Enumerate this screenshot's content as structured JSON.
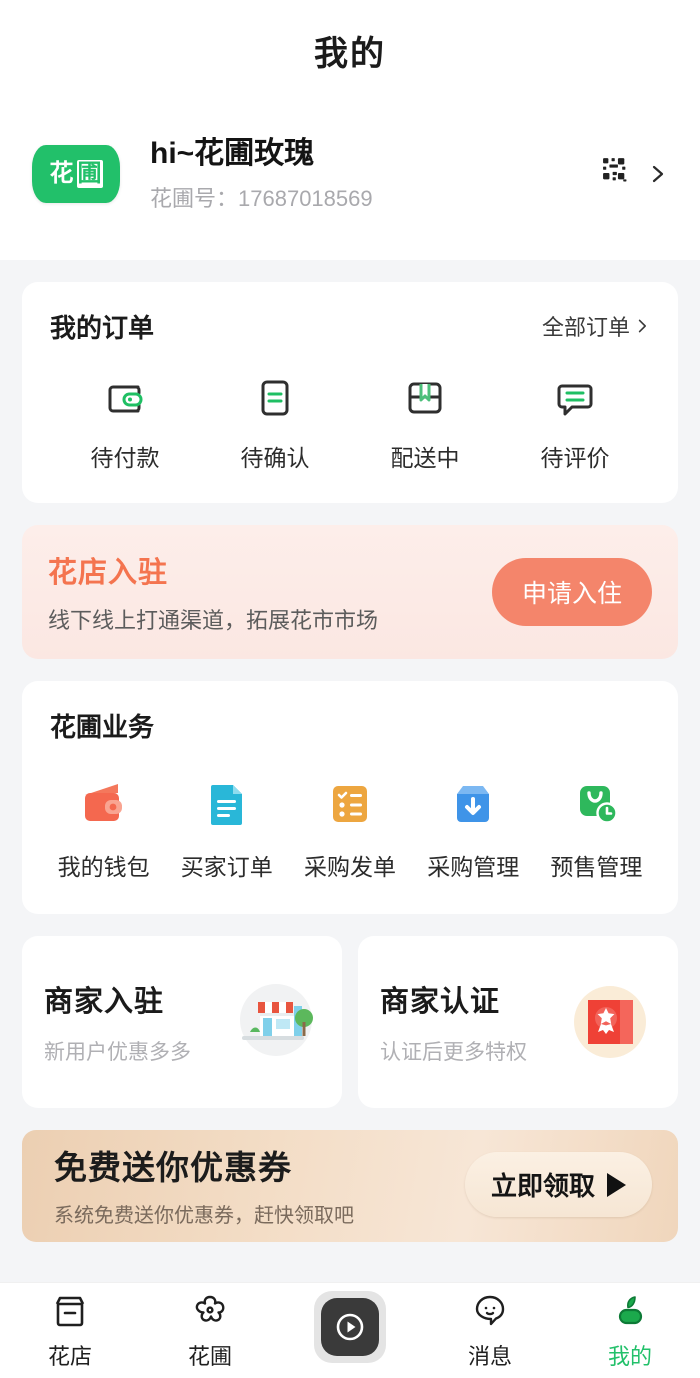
{
  "header": {
    "title": "我的"
  },
  "profile": {
    "avatar_chars": [
      "花",
      "圃"
    ],
    "name": "hi~花圃玫瑰",
    "id_label": "花圃号：",
    "id_value": "17687018569",
    "qr_icon": "qr-code-icon",
    "chevron_icon": "chevron-right-icon"
  },
  "orders": {
    "title": "我的订单",
    "more_label": "全部订单",
    "more_chevron": "chevron-right-icon",
    "items": [
      {
        "label": "待付款",
        "icon": "wallet-outline-icon"
      },
      {
        "label": "待确认",
        "icon": "document-outline-icon"
      },
      {
        "label": "配送中",
        "icon": "package-outline-icon"
      },
      {
        "label": "待评价",
        "icon": "chat-bubble-outline-icon"
      }
    ]
  },
  "shop_banner": {
    "title": "花店入驻",
    "subtitle": "线下线上打通渠道，拓展花市市场",
    "button_label": "申请入住",
    "title_color": "#f4744f",
    "button_color": "#f4856b"
  },
  "business": {
    "title": "花圃业务",
    "items": [
      {
        "label": "我的钱包",
        "icon": "wallet-filled-icon",
        "color": "#f4684f"
      },
      {
        "label": "买家订单",
        "icon": "document-filled-icon",
        "color": "#29b7d8"
      },
      {
        "label": "采购发单",
        "icon": "checklist-icon",
        "color": "#eda640"
      },
      {
        "label": "采购管理",
        "icon": "inbox-download-icon",
        "color": "#3f94e8"
      },
      {
        "label": "预售管理",
        "icon": "clock-tag-icon",
        "color": "#2eb85c"
      }
    ]
  },
  "promos": [
    {
      "title": "商家入驻",
      "subtitle": "新用户优惠多多",
      "art": "storefront-illustration"
    },
    {
      "title": "商家认证",
      "subtitle": "认证后更多特权",
      "art": "certificate-badge-illustration"
    }
  ],
  "coupon": {
    "title": "免费送你优惠券",
    "subtitle": "系统免费送你优惠券，赶快领取吧",
    "button_label": "立即领取",
    "button_arrow": "play-triangle-icon"
  },
  "tabbar": {
    "active_color": "#22c06a",
    "items": [
      {
        "label": "花店",
        "icon": "storefront-icon",
        "active": false
      },
      {
        "label": "花圃",
        "icon": "flower-icon",
        "active": false
      },
      {
        "label": "",
        "icon": "play-button-icon",
        "active": false
      },
      {
        "label": "消息",
        "icon": "message-face-icon",
        "active": false
      },
      {
        "label": "我的",
        "icon": "person-leaf-icon",
        "active": true
      }
    ]
  }
}
